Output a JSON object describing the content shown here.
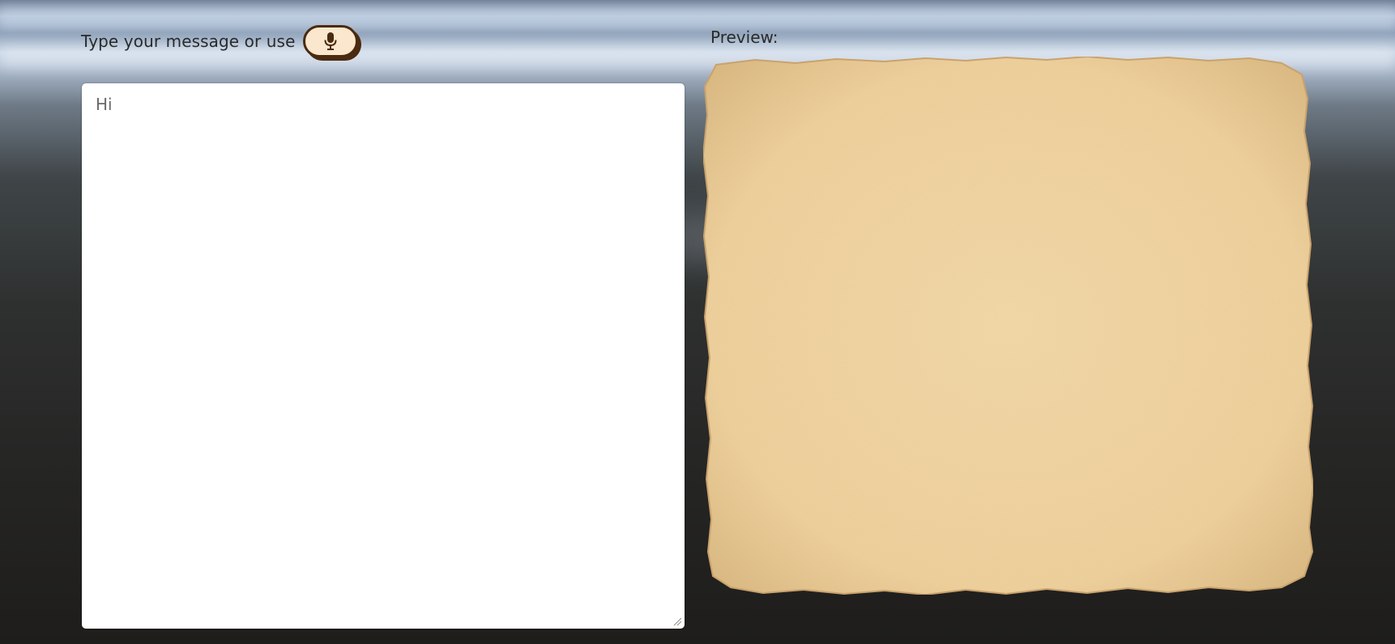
{
  "composer": {
    "prompt_label": "Type your message or use",
    "mic_icon": "microphone-icon",
    "message_value": "Hi"
  },
  "preview": {
    "label": "Preview:"
  },
  "colors": {
    "mic_button_fill": "#fbe7cd",
    "mic_button_border": "#4a2a10",
    "paper_fill": "#f0d3a0",
    "paper_edge": "#d9b67e",
    "textarea_bg": "#ffffff"
  }
}
